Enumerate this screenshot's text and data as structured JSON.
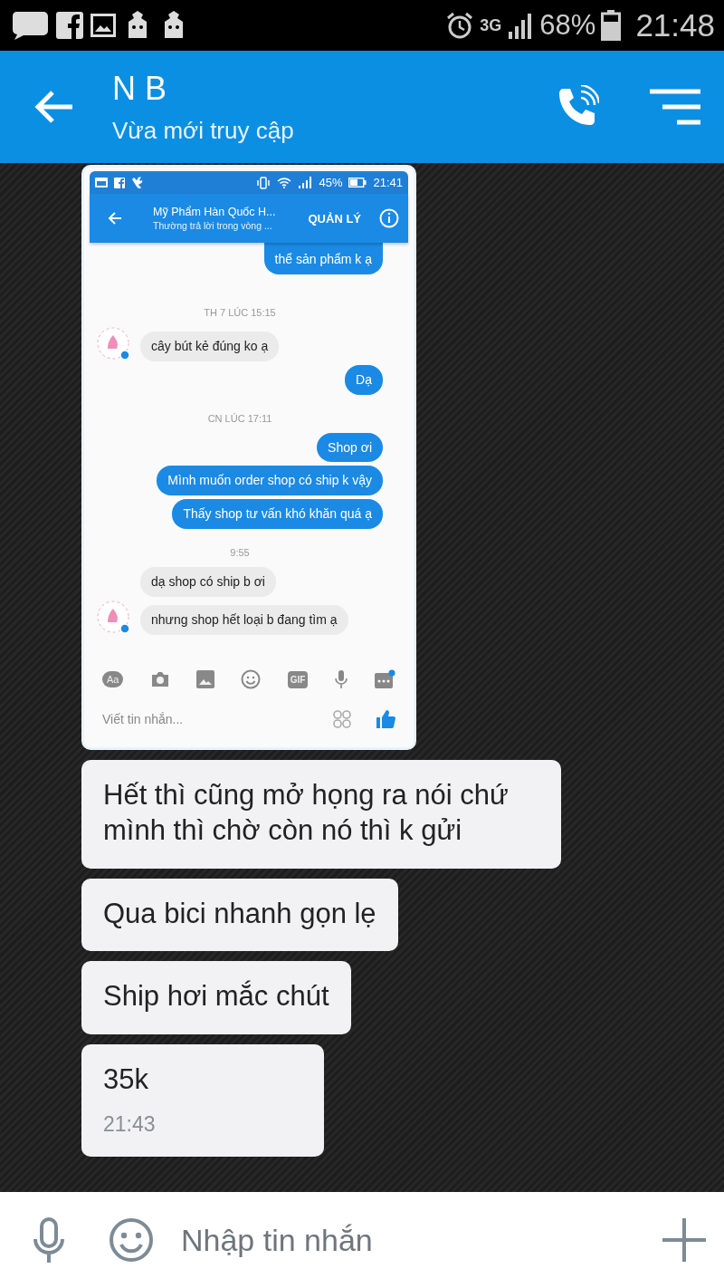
{
  "status_bar": {
    "network": "3G",
    "battery": "68%",
    "time": "21:48"
  },
  "header": {
    "title": "N B",
    "subtitle": "Vừa mới truy cập"
  },
  "shared_screenshot": {
    "status_bar": {
      "battery": "45%",
      "time": "21:41"
    },
    "header": {
      "title": "Mỹ Phẩm Hàn Quốc H...",
      "subtitle": "Thường trả lời trong vòng ...",
      "action": "QUẢN LÝ"
    },
    "messages": [
      {
        "kind": "outgoing",
        "text": "thể sản phẩm k ạ"
      },
      {
        "kind": "timestamp",
        "text": "TH 7 LÚC 15:15"
      },
      {
        "kind": "incoming",
        "text": "cây bút kẻ đúng ko ạ",
        "avatar": true
      },
      {
        "kind": "outgoing",
        "text": "Dạ"
      },
      {
        "kind": "timestamp",
        "text": "CN LÚC 17:11"
      },
      {
        "kind": "outgoing",
        "text": "Shop ơi"
      },
      {
        "kind": "outgoing",
        "text": "Mình muốn order shop có ship k vậy"
      },
      {
        "kind": "outgoing",
        "text": "Thấy shop tư vấn khó khăn quá ạ"
      },
      {
        "kind": "timestamp",
        "text": "9:55"
      },
      {
        "kind": "incoming",
        "text": "dạ shop có ship b ơi",
        "avatar": false
      },
      {
        "kind": "incoming",
        "text": "nhưng shop hết loại b đang tìm ạ",
        "avatar": true
      }
    ],
    "toolbar": {
      "text_button": "Aa",
      "gif_button": "GIF"
    },
    "composer": {
      "placeholder": "Viết tin nhắn..."
    }
  },
  "messages": [
    {
      "text": "Hết thì cũng mở họng ra nói chứ mình thì chờ còn nó thì k gửi"
    },
    {
      "text": "Qua bici nhanh gọn lẹ"
    },
    {
      "text": "Ship hơi mắc chút"
    },
    {
      "text": "35k",
      "time": "21:43"
    }
  ],
  "composer": {
    "placeholder": "Nhập tin nhắn"
  }
}
